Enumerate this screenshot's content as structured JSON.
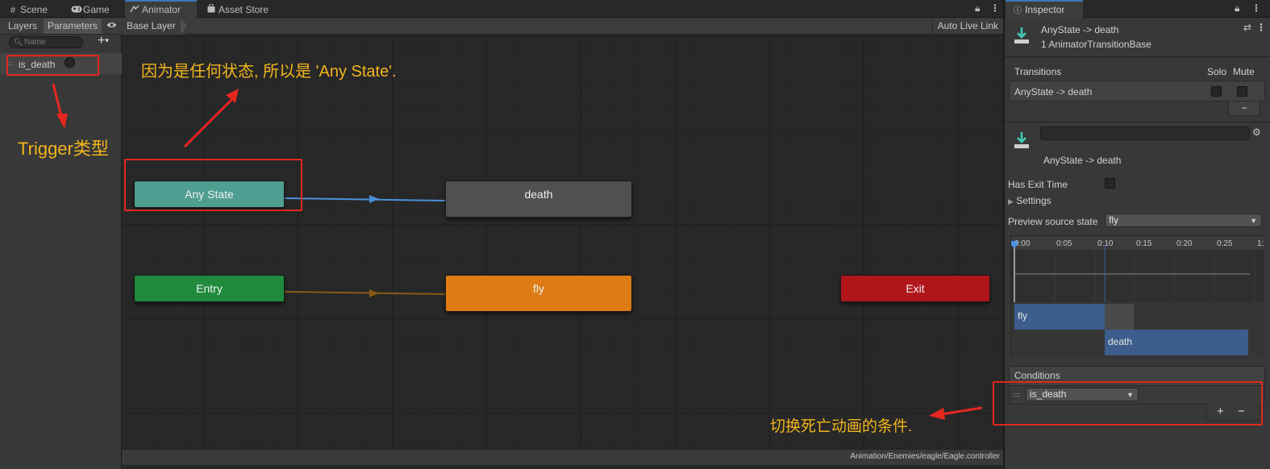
{
  "tabs": {
    "scene": "Scene",
    "game": "Game",
    "animator": "Animator",
    "asset_store": "Asset Store"
  },
  "left_panel": {
    "tab_layers": "Layers",
    "tab_parameters": "Parameters",
    "search_placeholder": "Name",
    "add_label": "+",
    "parameters": [
      {
        "name": "is_death",
        "type": "Trigger"
      }
    ]
  },
  "graph": {
    "breadcrumb": "Base Layer",
    "auto_live_link": "Auto Live Link",
    "status_path": "Animation/Enemies/eagle/Eagle.controller",
    "nodes": {
      "any_state": "Any State",
      "death": "death",
      "entry": "Entry",
      "fly": "fly",
      "exit": "Exit"
    },
    "colors": {
      "any_state": "#4e9e91",
      "death": "#505052",
      "entry": "#1f8a3b",
      "fly": "#de7b14",
      "exit": "#b0161a",
      "transition_blue": "#4a90d9",
      "transition_orange": "#8a5a14"
    }
  },
  "inspector": {
    "tab_title": "Inspector",
    "header_title": "AnyState -> death",
    "header_subtitle": "1 AnimatorTransitionBase",
    "transitions_label": "Transitions",
    "solo_label": "Solo",
    "mute_label": "Mute",
    "transition_row": "AnyState -> death",
    "minus_label": "−",
    "transition_name_sub": "AnyState -> death",
    "has_exit_time_label": "Has Exit Time",
    "settings_label": "Settings",
    "preview_source_label": "Preview source state",
    "preview_source_value": "fly",
    "timeline_ticks": [
      "0:00",
      "0:05",
      "0:10",
      "0:15",
      "0:20",
      "0:25",
      "1:"
    ],
    "timeline_fly": "fly",
    "timeline_death": "death",
    "conditions_label": "Conditions",
    "condition_param": "is_death",
    "plus_label": "+",
    "minus2_label": "−"
  },
  "annotations": {
    "any_state_note": "因为是任何状态, 所以是 'Any State'.",
    "trigger_note": "Trigger类型",
    "condition_note": "切换死亡动画的条件."
  }
}
